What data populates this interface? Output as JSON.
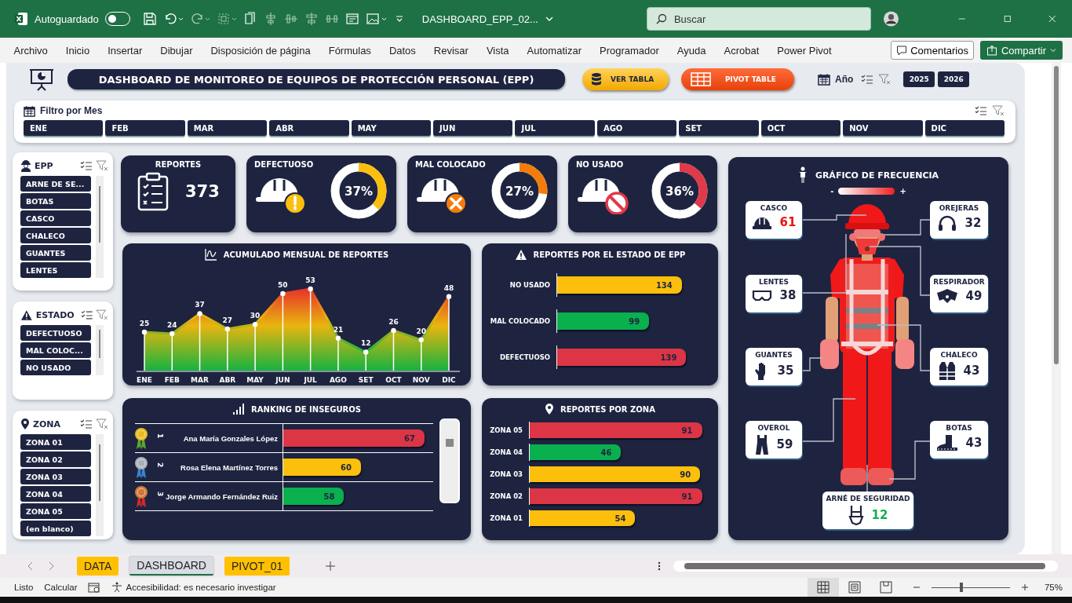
{
  "titlebar": {
    "autosave_label": "Autoguardado",
    "autosave_on": false,
    "filename": "DASHBOARD_EPP_02...",
    "search": {
      "placeholder": "Buscar"
    }
  },
  "menu": [
    "Archivo",
    "Inicio",
    "Insertar",
    "Dibujar",
    "Disposición de página",
    "Fórmulas",
    "Datos",
    "Revisar",
    "Vista",
    "Automatizar",
    "Programador",
    "Ayuda",
    "Acrobat",
    "Power Pivot"
  ],
  "ribbon_buttons": {
    "comments": "Comentarios",
    "share": "Compartir"
  },
  "dashboard": {
    "title": "DASHBOARD DE MONITOREO DE EQUIPOS DE PROTECCIÓN PERSONAL (EPP)",
    "buttons": [
      {
        "kind": "table",
        "label": "VER TABLA"
      },
      {
        "kind": "pivot",
        "label": "PIVOT TABLE"
      }
    ],
    "year_filter": {
      "label": "Año",
      "years": [
        {
          "label": "2025",
          "selected": true
        },
        {
          "label": "2026",
          "selected": true
        }
      ]
    }
  },
  "month_filter": {
    "title": "Filtro por Mes",
    "months": [
      {
        "label": "ENE",
        "selected": true
      },
      {
        "label": "FEB",
        "selected": true
      },
      {
        "label": "MAR",
        "selected": true
      },
      {
        "label": "ABR",
        "selected": true
      },
      {
        "label": "MAY",
        "selected": true
      },
      {
        "label": "JUN",
        "selected": true
      },
      {
        "label": "JUL",
        "selected": true
      },
      {
        "label": "AGO",
        "selected": true
      },
      {
        "label": "SET",
        "selected": true
      },
      {
        "label": "OCT",
        "selected": true
      },
      {
        "label": "NOV",
        "selected": true
      },
      {
        "label": "DIC",
        "selected": true
      }
    ]
  },
  "slicers": [
    {
      "kind": "epp",
      "title": "EPP",
      "items": [
        {
          "label": "ARNE DE SE...",
          "selected": true
        },
        {
          "label": "BOTAS",
          "selected": true
        },
        {
          "label": "CASCO",
          "selected": true
        },
        {
          "label": "CHALECO",
          "selected": true
        },
        {
          "label": "GUANTES",
          "selected": true
        },
        {
          "label": "LENTES",
          "selected": true
        }
      ]
    },
    {
      "kind": "estado",
      "title": "ESTADO",
      "items": [
        {
          "label": "DEFECTUOSO",
          "selected": true
        },
        {
          "label": "MAL COLOC...",
          "selected": true
        },
        {
          "label": "NO USADO",
          "selected": true
        }
      ]
    },
    {
      "kind": "zona",
      "title": "ZONA",
      "items": [
        {
          "label": "ZONA 01",
          "selected": true
        },
        {
          "label": "ZONA 02",
          "selected": true
        },
        {
          "label": "ZONA 03",
          "selected": true
        },
        {
          "label": "ZONA 04",
          "selected": true
        },
        {
          "label": "ZONA 05",
          "selected": true
        },
        {
          "label": "(en blanco)",
          "selected": true
        }
      ]
    }
  ],
  "kpis": [
    {
      "kind": "total",
      "title": "REPORTES",
      "value": "373"
    },
    {
      "kind": "warning",
      "title": "DEFECTUOSO",
      "value": "37%",
      "level": 0.37,
      "color": "#fbbf0f"
    },
    {
      "kind": "cross",
      "title": "MAL COLOCADO",
      "value": "27%",
      "level": 0.27,
      "color": "#f47c0a"
    },
    {
      "kind": "forbidden",
      "title": "NO USADO",
      "value": "36%",
      "level": 0.36,
      "color": "#e0394a"
    }
  ],
  "monthly_chart": {
    "title": "ACUMULADO MENSUAL DE REPORTES",
    "chart_data": {
      "type": "area",
      "categories": [
        "ENE",
        "FEB",
        "MAR",
        "ABR",
        "MAY",
        "JUN",
        "JUL",
        "AGO",
        "SET",
        "OCT",
        "NOV",
        "DIC"
      ],
      "values": [
        25,
        24,
        37,
        27,
        30,
        50,
        53,
        21,
        12,
        26,
        20,
        48
      ],
      "data_labels": true,
      "grid": true
    }
  },
  "estado_chart": {
    "title": "REPORTES POR EL ESTADO DE EPP",
    "rows": [
      {
        "label": "NO USADO",
        "value": "134",
        "level": 0.84,
        "color": "#fcbf0c"
      },
      {
        "label": "MAL COLOCADO",
        "value": "99",
        "level": 0.62,
        "color": "#0aaf4e"
      },
      {
        "label": "DEFECTUOSO",
        "value": "139",
        "level": 0.87,
        "color": "#dc3545"
      }
    ]
  },
  "ranking": {
    "title": "RANKING DE INSEGUROS",
    "rows": [
      {
        "rank": "1",
        "name": "Ana María Gonzales López",
        "value": "67",
        "level": 1.0,
        "color": "#dc3545"
      },
      {
        "rank": "2",
        "name": "Rosa Elena Martínez Torres",
        "value": "60",
        "level": 0.55,
        "color": "#fcbf0c"
      },
      {
        "rank": "3",
        "name": "Jorge Armando Fernández Ruiz",
        "value": "58",
        "level": 0.43,
        "color": "#0aaf4e"
      }
    ]
  },
  "zona_chart": {
    "title": "REPORTES POR ZONA",
    "rows": [
      {
        "label": "ZONA 05",
        "value": "91",
        "level": 0.98,
        "color": "#dc3545"
      },
      {
        "label": "ZONA 04",
        "value": "46",
        "level": 0.52,
        "color": "#0aaf4e"
      },
      {
        "label": "ZONA 03",
        "value": "90",
        "level": 0.97,
        "color": "#fcbf0c"
      },
      {
        "label": "ZONA 02",
        "value": "91",
        "level": 0.98,
        "color": "#dc3545"
      },
      {
        "label": "ZONA 01",
        "value": "54",
        "level": 0.6,
        "color": "#fcbf0c"
      }
    ]
  },
  "frequency": {
    "title": "GRÁFICO DE FRECUENCIA",
    "legend_min": "-",
    "legend_max": "+",
    "items": [
      {
        "kind": "casco",
        "label": "CASCO",
        "value": "61",
        "color": "#ee1111"
      },
      {
        "kind": "orejeras",
        "label": "OREJERAS",
        "value": "32",
        "color": "#1e2440"
      },
      {
        "kind": "lentes",
        "label": "LENTES",
        "value": "38",
        "color": "#1e2440"
      },
      {
        "kind": "respirador",
        "label": "RESPIRADOR",
        "value": "49",
        "color": "#1e2440"
      },
      {
        "kind": "guantes",
        "label": "GUANTES",
        "value": "35",
        "color": "#1e2440"
      },
      {
        "kind": "chaleco",
        "label": "CHALECO",
        "value": "43",
        "color": "#1e2440"
      },
      {
        "kind": "overol",
        "label": "OVEROL",
        "value": "59",
        "color": "#1e2440"
      },
      {
        "kind": "botas",
        "label": "BOTAS",
        "value": "43",
        "color": "#1e2440"
      },
      {
        "kind": "arnes",
        "label": "ARNÉ DE SEGURIDAD",
        "value": "12",
        "color": "#12b04c"
      }
    ]
  },
  "sheet_tabs": [
    {
      "label": "DATA",
      "selected": false,
      "color": "#ffc000"
    },
    {
      "label": "DASHBOARD",
      "selected": true,
      "color": "#d9dde3"
    },
    {
      "label": "PIVOT_01",
      "selected": false,
      "color": "#ffc000"
    }
  ],
  "status": {
    "ready": "Listo",
    "calc": "Calcular",
    "accessibility": "Accesibilidad: es necesario investigar",
    "zoom": "75%",
    "level": 0.38
  }
}
